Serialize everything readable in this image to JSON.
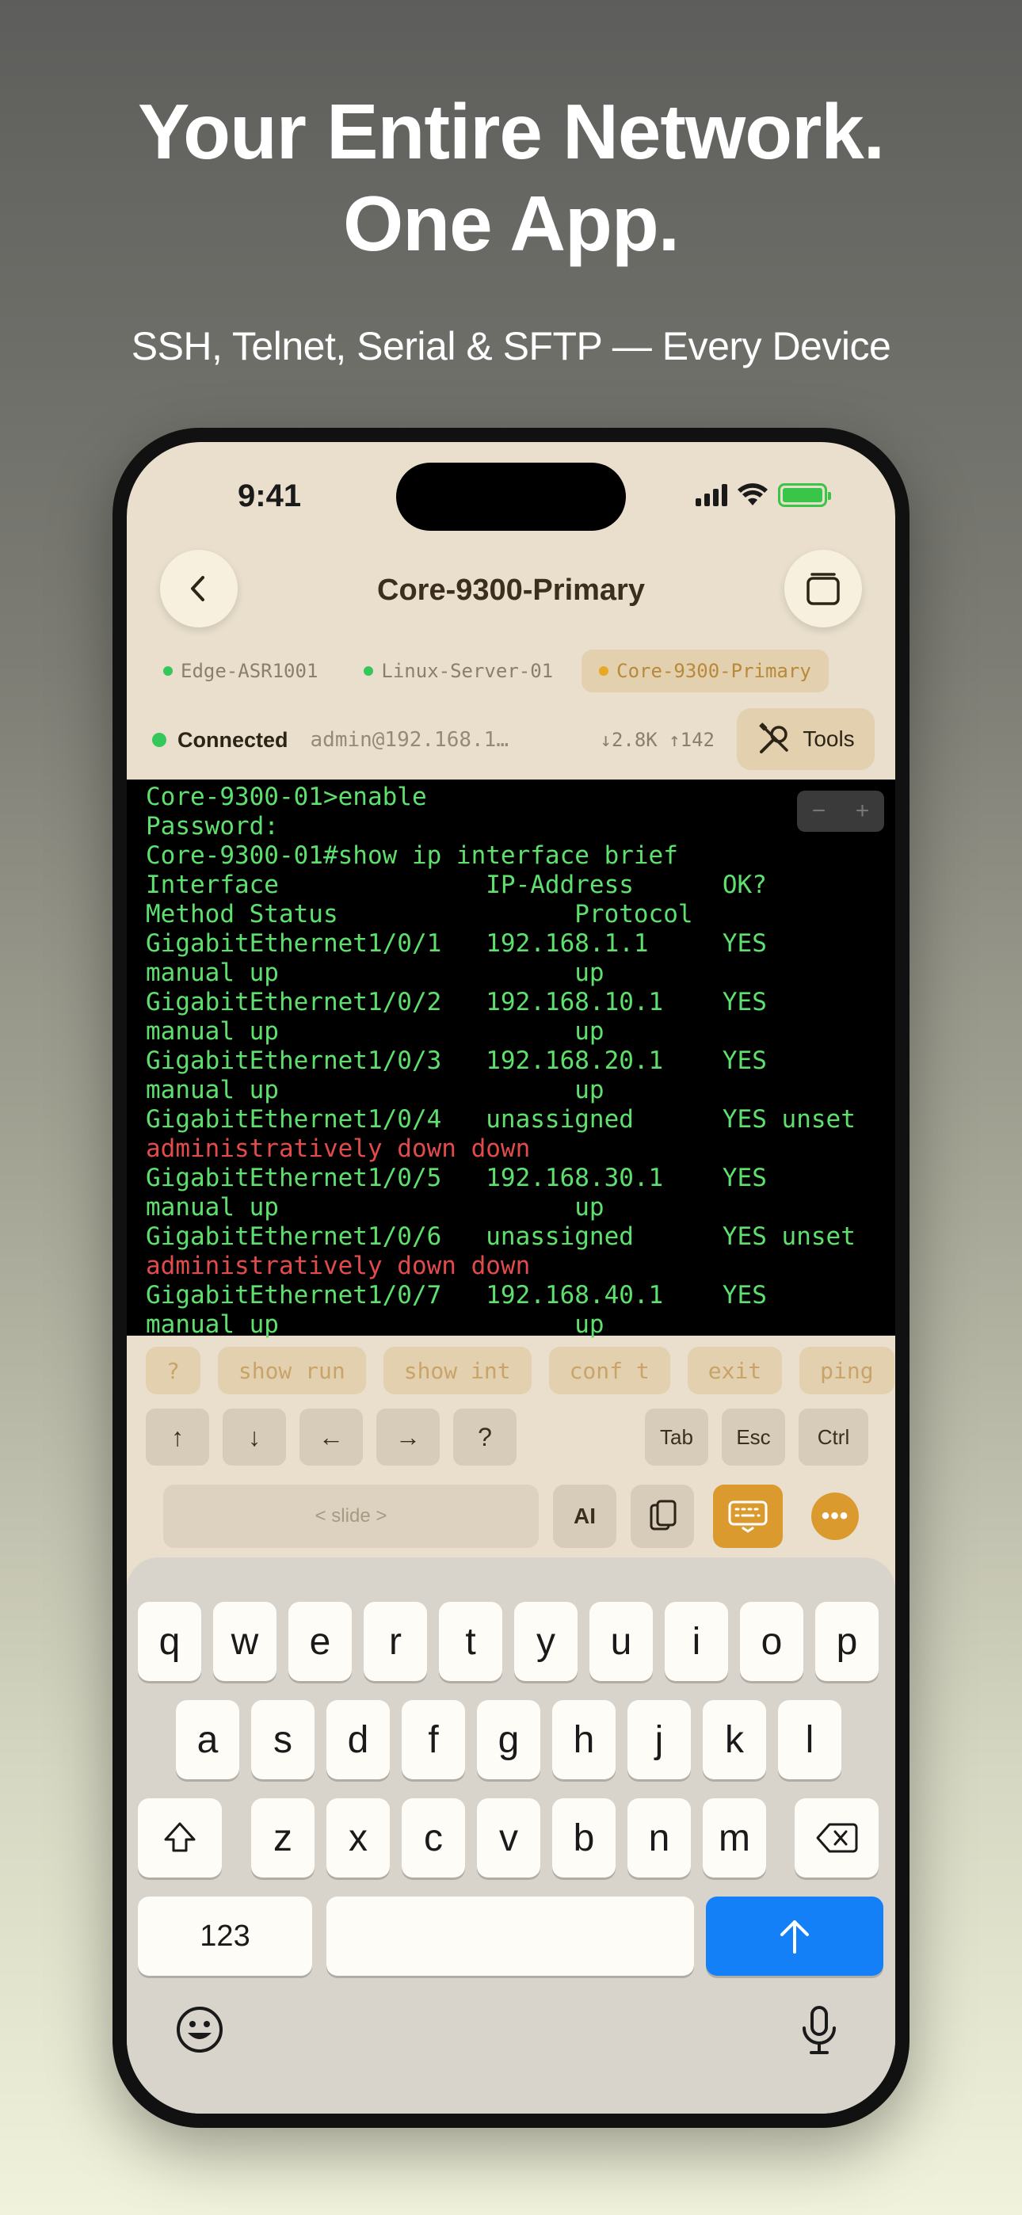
{
  "promo": {
    "headline_line1": "Your Entire Network.",
    "headline_line2": "One App.",
    "subheadline": "SSH, Telnet, Serial & SFTP — Every Device"
  },
  "status_bar": {
    "time": "9:41"
  },
  "header": {
    "title": "Core-9300-Primary"
  },
  "sessions": [
    {
      "label": "Edge-ASR1001",
      "active": false
    },
    {
      "label": "Linux-Server-01",
      "active": false
    },
    {
      "label": "Core-9300-Primary",
      "active": true
    }
  ],
  "connection": {
    "status": "Connected",
    "host": "admin@192.168.1…",
    "rx": "↓2.8K",
    "tx": "↑142",
    "tools_label": "Tools"
  },
  "terminal": {
    "zoom_minus": "−",
    "zoom_plus": "+",
    "lines": [
      {
        "text": "Core-9300-01>enable",
        "color": "green"
      },
      {
        "text": "Password:",
        "color": "green"
      },
      {
        "text": "Core-9300-01#show ip interface brief",
        "color": "green"
      },
      {
        "text": "Interface              IP-Address      OK?",
        "color": "green"
      },
      {
        "text": "Method Status                Protocol",
        "color": "green"
      },
      {
        "text": "GigabitEthernet1/0/1   192.168.1.1     YES",
        "color": "green"
      },
      {
        "text": "manual up                    up",
        "color": "green"
      },
      {
        "text": "GigabitEthernet1/0/2   192.168.10.1    YES",
        "color": "green"
      },
      {
        "text": "manual up                    up",
        "color": "green"
      },
      {
        "text": "GigabitEthernet1/0/3   192.168.20.1    YES",
        "color": "green"
      },
      {
        "text": "manual up                    up",
        "color": "green"
      },
      {
        "text": "GigabitEthernet1/0/4   unassigned      YES unset",
        "color": "green"
      },
      {
        "text": "administratively down down",
        "color": "red"
      },
      {
        "text": "GigabitEthernet1/0/5   192.168.30.1    YES",
        "color": "green"
      },
      {
        "text": "manual up                    up",
        "color": "green"
      },
      {
        "text": "GigabitEthernet1/0/6   unassigned      YES unset",
        "color": "green"
      },
      {
        "text": "administratively down down",
        "color": "red"
      },
      {
        "text": "GigabitEthernet1/0/7   192.168.40.1    YES",
        "color": "green"
      },
      {
        "text": "manual up                    up",
        "color": "green"
      }
    ]
  },
  "quick_commands": [
    "?",
    "show run",
    "show int",
    "conf t",
    "exit",
    "ping"
  ],
  "nav_keys": {
    "up": "↑",
    "down": "↓",
    "left": "←",
    "right": "→",
    "help": "?",
    "tab": "Tab",
    "esc": "Esc",
    "ctrl": "Ctrl"
  },
  "toolbar": {
    "slide_label": "< slide >",
    "ai_label": "AI",
    "more_label": "•••"
  },
  "keyboard": {
    "row1": [
      "q",
      "w",
      "e",
      "r",
      "t",
      "y",
      "u",
      "i",
      "o",
      "p"
    ],
    "row2": [
      "a",
      "s",
      "d",
      "f",
      "g",
      "h",
      "j",
      "k",
      "l"
    ],
    "row3": [
      "z",
      "x",
      "c",
      "v",
      "b",
      "n",
      "m"
    ],
    "numbers_label": "123"
  },
  "colors": {
    "accent": "#db9a2e",
    "connected": "#34c759",
    "terminal_green": "#5ee06e",
    "terminal_red": "#e24b4b",
    "send_blue": "#1480f8"
  }
}
